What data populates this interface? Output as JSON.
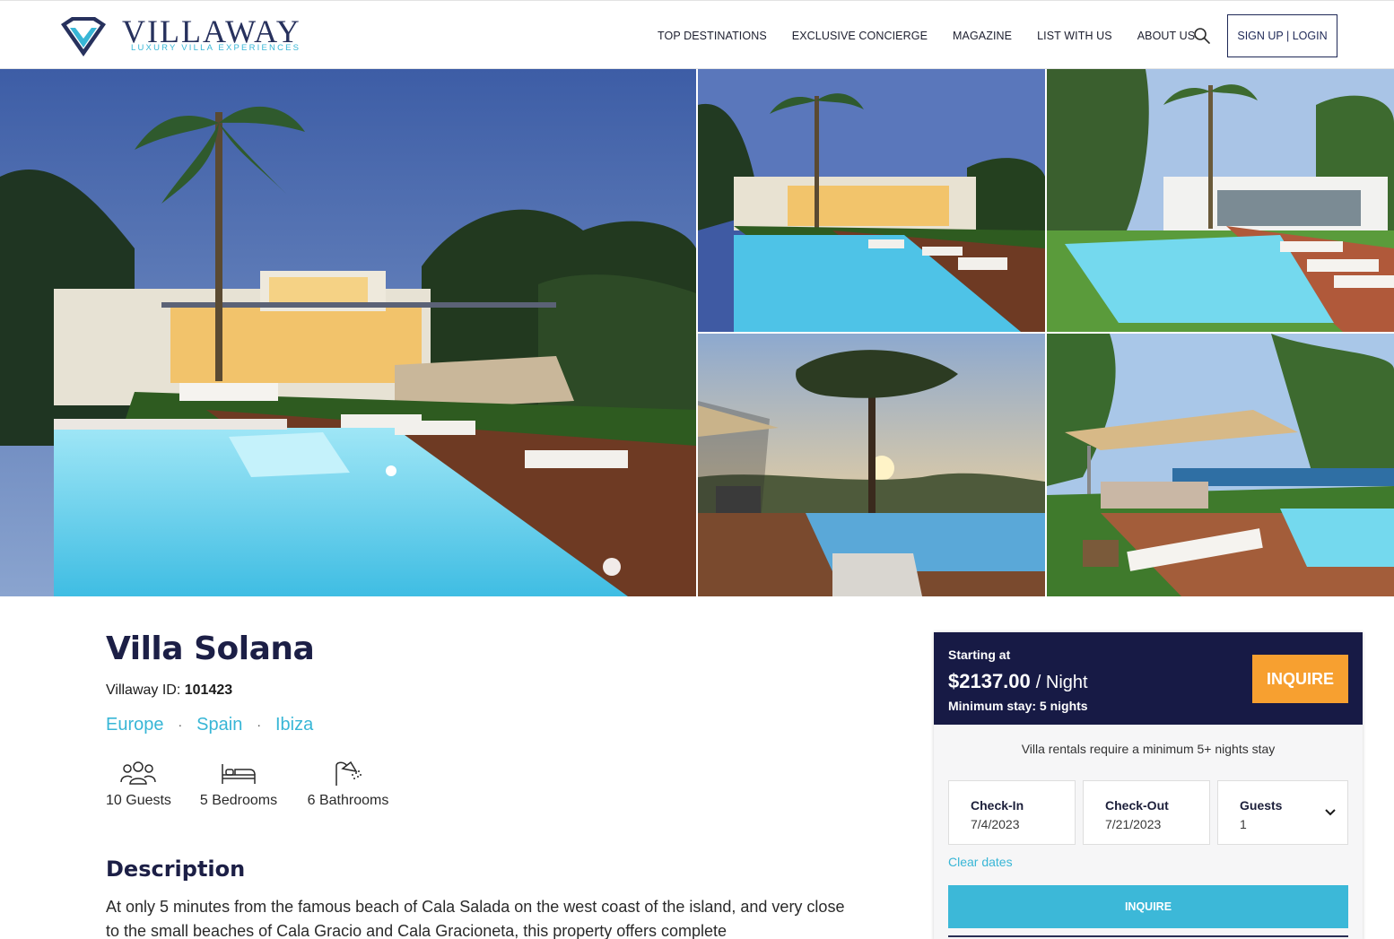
{
  "brand": {
    "name": "VILLAWAY",
    "tagline": "LUXURY VILLA EXPERIENCES",
    "colors": {
      "navy": "#1c1f46",
      "accent": "#38b6d6",
      "orange": "#f7a030"
    }
  },
  "nav": {
    "items": [
      "TOP DESTINATIONS",
      "EXCLUSIVE CONCIERGE",
      "MAGAZINE",
      "LIST WITH US",
      "ABOUT US"
    ],
    "signup_label": "SIGN UP | LOGIN",
    "search_icon": "search-icon"
  },
  "villa": {
    "title": "Villa Solana",
    "id_label": "Villaway ID:",
    "id_value": "101423",
    "breadcrumbs": [
      "Europe",
      "Spain",
      "Ibiza"
    ],
    "amenities": [
      {
        "icon": "guests-icon",
        "label": "10 Guests"
      },
      {
        "icon": "bed-icon",
        "label": "5 Bedrooms"
      },
      {
        "icon": "shower-icon",
        "label": "6 Bathrooms"
      }
    ],
    "description_heading": "Description",
    "description": "At only 5 minutes from the famous beach of Cala Salada on the west coast of the island, and very close to the small beaches of Cala Gracio and Cala Gracioneta, this property offers complete"
  },
  "booking": {
    "starting_label": "Starting at",
    "price": "$2137.00",
    "per": "/ Night",
    "min_stay": "Minimum stay: 5 nights",
    "inquire_top": "INQUIRE",
    "note": "Villa rentals require a minimum 5+ nights stay",
    "checkin_label": "Check-In",
    "checkin_value": "7/4/2023",
    "checkout_label": "Check-Out",
    "checkout_value": "7/21/2023",
    "guests_label": "Guests",
    "guests_value": "1",
    "clear_dates": "Clear dates",
    "inquire_main": "INQUIRE"
  }
}
